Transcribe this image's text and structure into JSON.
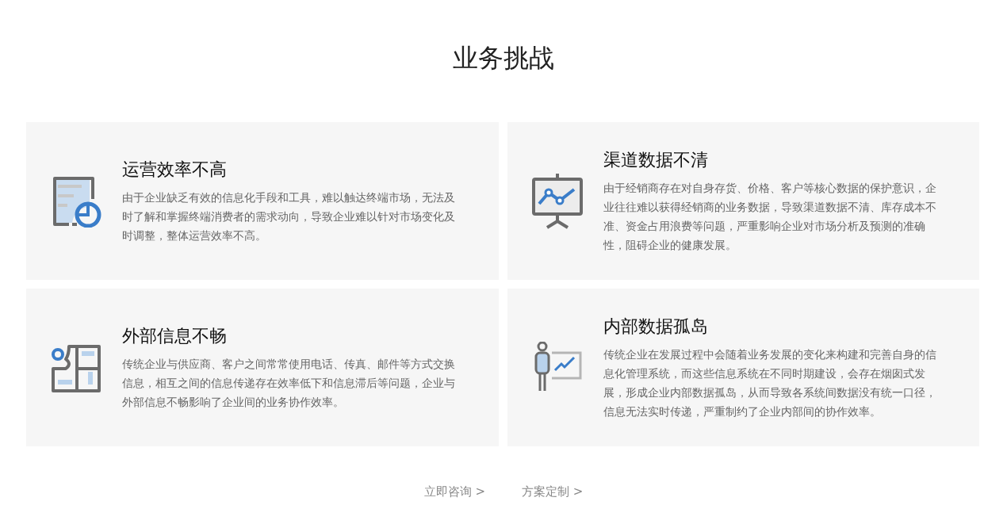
{
  "title": "业务挑战",
  "cards": [
    {
      "kind": "tablet",
      "title": "运营效率不高",
      "text": "由于企业缺乏有效的信息化手段和工具，难以触达终端市场，无法及时了解和掌握终端消费者的需求动向，导致企业难以针对市场变化及时调整，整体运营效率不高。"
    },
    {
      "kind": "board",
      "title": "渠道数据不清",
      "text": "由于经销商存在对自身存货、价格、客户等核心数据的保护意识，企业往往难以获得经销商的业务数据，导致渠道数据不清、库存成本不准、资金占用浪费等问题，严重影响企业对市场分析及预测的准确性，阻碍企业的健康发展。"
    },
    {
      "kind": "puzzle",
      "title": "外部信息不畅",
      "text": "传统企业与供应商、客户之间常常使用电话、传真、邮件等方式交换信息，相互之间的信息传递存在效率低下和信息滞后等问题，企业与外部信息不畅影响了企业间的业务协作效率。"
    },
    {
      "kind": "presenter",
      "title": "内部数据孤岛",
      "text": "传统企业在发展过程中会随着业务发展的变化来构建和完善自身的信息化管理系统，而这些信息系统在不同时期建设，会存在烟囱式发展，形成企业内部数据孤岛，从而导致各系统间数据没有统一口径，信息无法实时传递，严重制约了企业内部间的协作效率。"
    }
  ],
  "links": [
    "立即咨询 >",
    "方案定制 >"
  ]
}
